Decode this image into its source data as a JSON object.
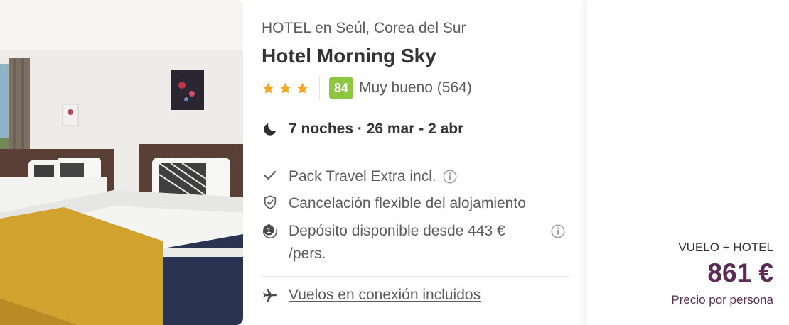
{
  "hotel": {
    "type_line": "HOTEL en Seúl, Corea del Sur",
    "name": "Hotel Morning Sky",
    "stars": 3,
    "score": "84",
    "score_text": "Muy bueno (564)",
    "dates": "7 noches · 26 mar - 2 abr"
  },
  "features": {
    "pack": "Pack Travel Extra incl.",
    "cancel": "Cancelación flexible del alojamiento",
    "deposit": "Depósito disponible desde 443 € /pers."
  },
  "flights_link": "Vuelos en conexión incluidos",
  "price": {
    "label": "VUELO + HOTEL",
    "value": "861 €",
    "sub": "Precio por persona"
  },
  "colors": {
    "accent_price": "#5b2a55",
    "score_badge": "#8dc63f",
    "star": "#f5a623"
  },
  "icons": [
    "moon-icon",
    "check-icon",
    "shield-check-icon",
    "deposit-icon",
    "info-icon",
    "plane-icon",
    "star-icon"
  ]
}
